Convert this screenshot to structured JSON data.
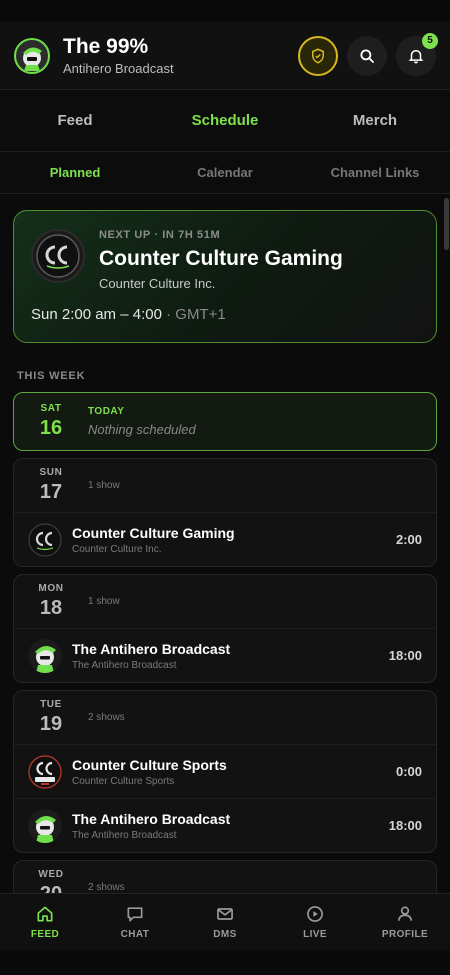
{
  "header": {
    "title": "The 99%",
    "subtitle": "Antihero Broadcast",
    "notification_count": "5"
  },
  "tabs": [
    {
      "label": "Feed"
    },
    {
      "label": "Schedule",
      "active": true
    },
    {
      "label": "Merch"
    }
  ],
  "subtabs": [
    {
      "label": "Planned",
      "active": true
    },
    {
      "label": "Calendar"
    },
    {
      "label": "Channel Links"
    }
  ],
  "next_up": {
    "eyebrow": "NEXT UP · IN 7H 51M",
    "title": "Counter Culture Gaming",
    "org": "Counter Culture Inc.",
    "time": "Sun 2:00 am – 4:00",
    "tz": "· GMT+1"
  },
  "section_label": "THIS WEEK",
  "today": {
    "dow": "SAT",
    "dom": "16",
    "label": "TODAY",
    "empty": "Nothing scheduled"
  },
  "days": [
    {
      "dow": "SUN",
      "dom": "17",
      "count": "1 show",
      "shows": [
        {
          "name": "Counter Culture Gaming",
          "org": "Counter Culture Inc.",
          "time": "2:00"
        }
      ]
    },
    {
      "dow": "MON",
      "dom": "18",
      "count": "1 show",
      "shows": [
        {
          "name": "The Antihero Broadcast",
          "org": "The Antihero Broadcast",
          "time": "18:00"
        }
      ]
    },
    {
      "dow": "TUE",
      "dom": "19",
      "count": "2 shows",
      "shows": [
        {
          "name": "Counter Culture Sports",
          "org": "Counter Culture Sports",
          "time": "0:00"
        },
        {
          "name": "The Antihero Broadcast",
          "org": "The Antihero Broadcast",
          "time": "18:00"
        }
      ]
    },
    {
      "dow": "WED",
      "dom": "20",
      "count": "2 shows",
      "shows": []
    }
  ],
  "nav": [
    {
      "label": "FEED",
      "active": true
    },
    {
      "label": "CHAT"
    },
    {
      "label": "DMS"
    },
    {
      "label": "LIVE"
    },
    {
      "label": "PROFILE"
    }
  ],
  "colors": {
    "accent": "#7ee04d",
    "shield_gold": "#d7b81c",
    "background": "#0b0b0b"
  }
}
